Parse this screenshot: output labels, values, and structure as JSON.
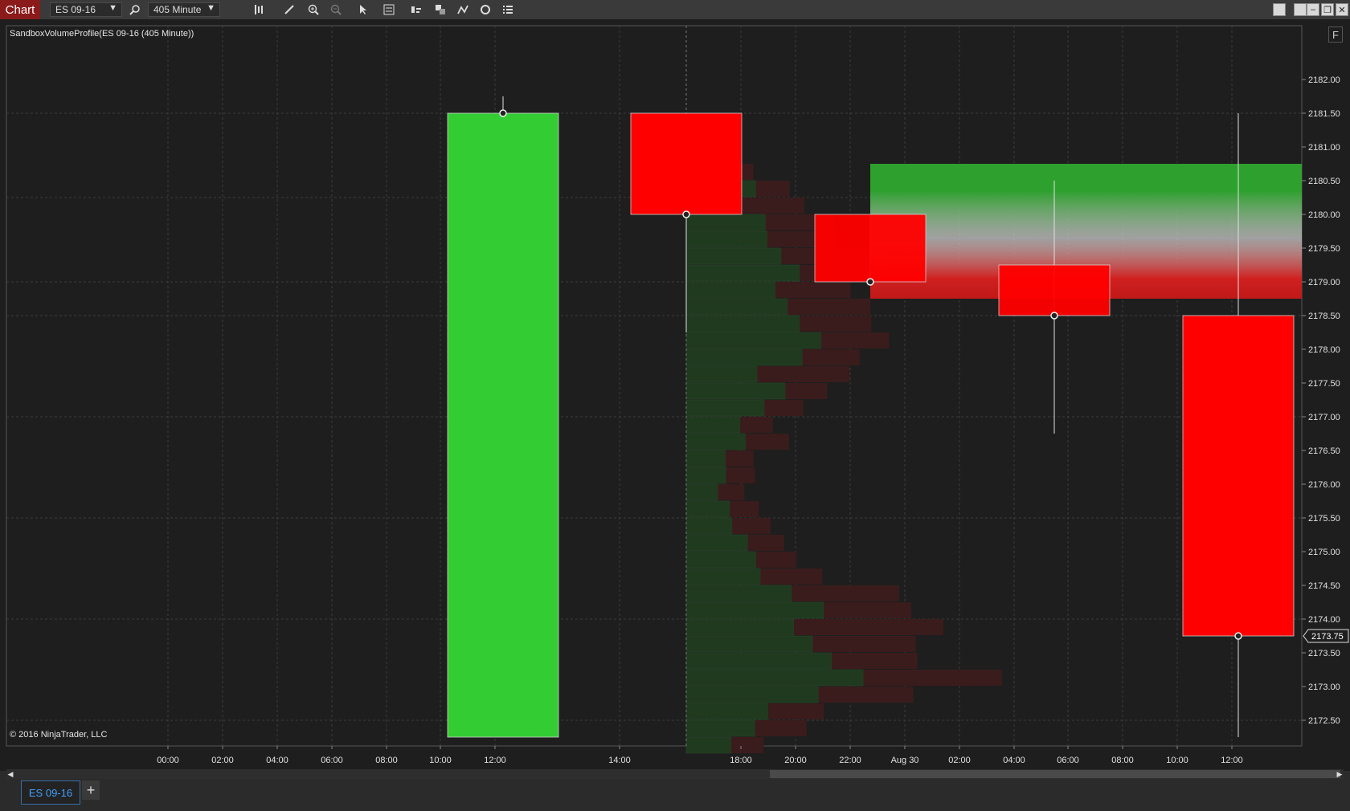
{
  "window": {
    "title_button": "Chart",
    "instrument": "ES 09-16",
    "interval": "405 Minute"
  },
  "toolbar": {
    "icons": [
      "search-icon",
      "bar-type-icon",
      "pencil-icon",
      "zoom-in-icon",
      "zoom-out-icon",
      "pointer-icon",
      "properties-icon",
      "strategies-icon",
      "data-series-icon",
      "indicators-icon",
      "refresh-icon",
      "list-icon"
    ]
  },
  "chart": {
    "indicator_label": "SandboxVolumeProfile(ES 09-16 (405 Minute))",
    "copyright": "© 2016 NinjaTrader, LLC",
    "f_label": "F",
    "current_price": "2173.75",
    "price_axis_labels": [
      "2182.00",
      "2181.50",
      "2181.00",
      "2180.50",
      "2180.00",
      "2179.50",
      "2179.00",
      "2178.50",
      "2178.00",
      "2177.50",
      "2177.00",
      "2176.50",
      "2176.00",
      "2175.50",
      "2175.00",
      "2174.50",
      "2174.00",
      "2173.50",
      "2173.00",
      "2172.50"
    ],
    "time_axis_labels": [
      "00:00",
      "02:00",
      "04:00",
      "06:00",
      "08:00",
      "10:00",
      "12:00",
      "14:00",
      "18:00",
      "20:00",
      "22:00",
      "Aug 30",
      "02:00",
      "04:00",
      "06:00",
      "08:00",
      "10:00",
      "12:00"
    ],
    "colors": {
      "up": "#33cc33",
      "down": "#ff0000",
      "background": "#1e1e1e",
      "grid": "#3a3a3a"
    }
  },
  "candles": [
    {
      "open": 2172.25,
      "high": 2181.75,
      "low": 2172.25,
      "close": 2181.5
    },
    {
      "open": 2181.5,
      "high": 2181.5,
      "low": 2178.25,
      "close": 2180.0
    },
    {
      "open": 2180.0,
      "high": 2180.0,
      "low": 2179.0,
      "close": 2179.0
    },
    {
      "open": 2179.25,
      "high": 2180.5,
      "low": 2176.75,
      "close": 2178.5
    },
    {
      "open": 2178.5,
      "high": 2181.5,
      "low": 2172.25,
      "close": 2173.75
    }
  ],
  "tabs": {
    "active": "ES 09-16",
    "add": "+"
  }
}
